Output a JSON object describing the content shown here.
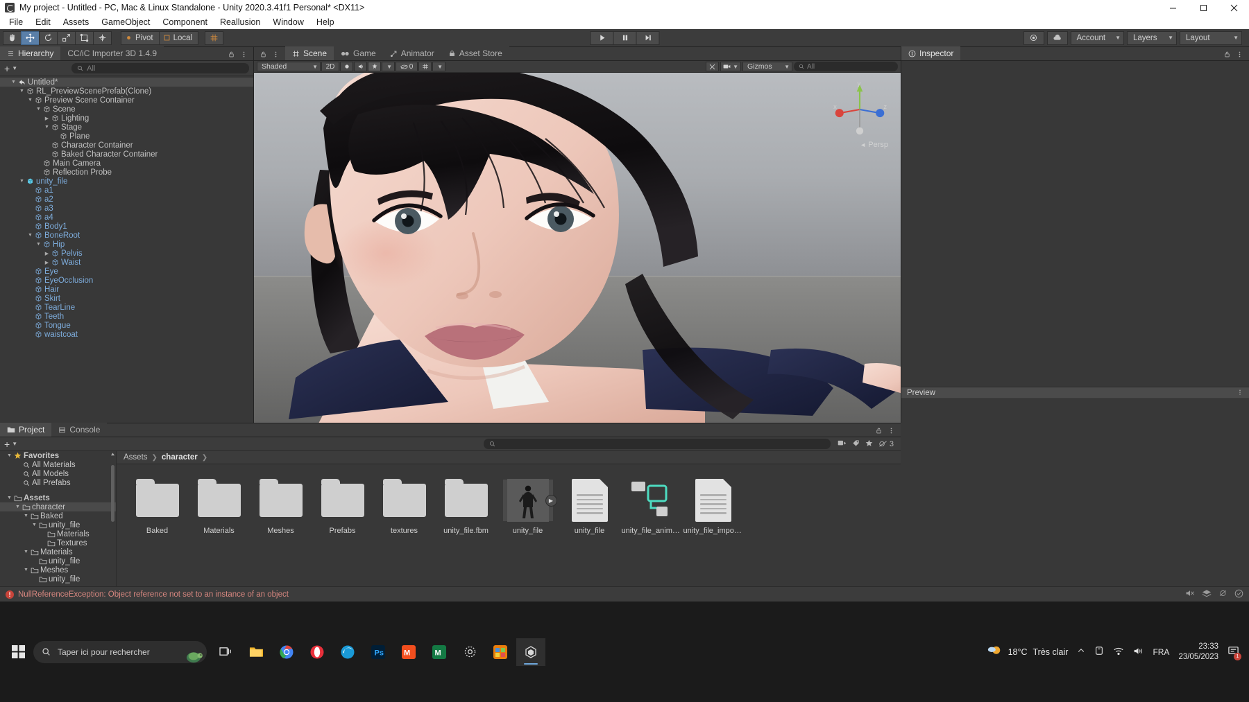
{
  "window": {
    "title": "My project - Untitled - PC, Mac & Linux Standalone - Unity 2020.3.41f1 Personal* <DX11>",
    "buttons": {
      "minimize": "minimize-icon",
      "maximize": "maximize-icon",
      "close": "close-icon"
    }
  },
  "menubar": {
    "items": [
      "File",
      "Edit",
      "Assets",
      "GameObject",
      "Component",
      "Reallusion",
      "Window",
      "Help"
    ]
  },
  "toolbar": {
    "tools": [
      {
        "name": "hand-tool",
        "glyph": "✋"
      },
      {
        "name": "move-tool",
        "glyph": "✥"
      },
      {
        "name": "rotate-tool",
        "glyph": "↻"
      },
      {
        "name": "scale-tool",
        "glyph": "◱"
      },
      {
        "name": "rect-tool",
        "glyph": "▧"
      },
      {
        "name": "transform-tool",
        "glyph": "✲"
      }
    ],
    "pivot_label": "Pivot",
    "local_label": "Local",
    "grid_toggle": "grid-snap-icon",
    "play": "▶",
    "pause": "❘❘",
    "step": "▶❘",
    "collab_label": "collab-icon",
    "cloud_label": "cloud-icon",
    "account_label": "Account",
    "layers_label": "Layers",
    "layout_label": "Layout"
  },
  "hierarchy": {
    "tabs": [
      {
        "label": "Hierarchy",
        "active": true,
        "icon": "hierarchy-icon"
      },
      {
        "label": "CC/iC Importer 3D 1.4.9",
        "active": false,
        "icon": ""
      }
    ],
    "add_label": "+",
    "search_placeholder": "All",
    "items": [
      {
        "label": "Untitled*",
        "depth": 0,
        "twirl": "down",
        "icon": "scene-icon",
        "prefab": false,
        "selected": true
      },
      {
        "label": "RL_PreviewScenePrefab(Clone)",
        "depth": 1,
        "twirl": "down",
        "icon": "cube-icon",
        "prefab": false
      },
      {
        "label": "Preview Scene Container",
        "depth": 2,
        "twirl": "down",
        "icon": "cube-icon",
        "prefab": false
      },
      {
        "label": "Scene",
        "depth": 3,
        "twirl": "down",
        "icon": "cube-icon",
        "prefab": false
      },
      {
        "label": "Lighting",
        "depth": 4,
        "twirl": "right",
        "icon": "cube-icon",
        "prefab": false
      },
      {
        "label": "Stage",
        "depth": 4,
        "twirl": "down",
        "icon": "cube-icon",
        "prefab": false
      },
      {
        "label": "Plane",
        "depth": 5,
        "twirl": "none",
        "icon": "cube-icon",
        "prefab": false
      },
      {
        "label": "Character Container",
        "depth": 4,
        "twirl": "none",
        "icon": "cube-icon",
        "prefab": false
      },
      {
        "label": "Baked Character Container",
        "depth": 4,
        "twirl": "none",
        "icon": "cube-icon",
        "prefab": false
      },
      {
        "label": "Main Camera",
        "depth": 3,
        "twirl": "none",
        "icon": "cube-icon",
        "prefab": false
      },
      {
        "label": "Reflection Probe",
        "depth": 3,
        "twirl": "none",
        "icon": "cube-icon",
        "prefab": false
      },
      {
        "label": "unity_file",
        "depth": 1,
        "twirl": "down",
        "icon": "prefab-icon",
        "prefab": true
      },
      {
        "label": "a1",
        "depth": 2,
        "twirl": "none",
        "icon": "cube-icon",
        "prefab": true
      },
      {
        "label": "a2",
        "depth": 2,
        "twirl": "none",
        "icon": "cube-icon",
        "prefab": true
      },
      {
        "label": "a3",
        "depth": 2,
        "twirl": "none",
        "icon": "cube-icon",
        "prefab": true
      },
      {
        "label": "a4",
        "depth": 2,
        "twirl": "none",
        "icon": "cube-icon",
        "prefab": true
      },
      {
        "label": "Body1",
        "depth": 2,
        "twirl": "none",
        "icon": "cube-icon",
        "prefab": true
      },
      {
        "label": "BoneRoot",
        "depth": 2,
        "twirl": "down",
        "icon": "cube-icon",
        "prefab": true
      },
      {
        "label": "Hip",
        "depth": 3,
        "twirl": "down",
        "icon": "cube-icon",
        "prefab": true
      },
      {
        "label": "Pelvis",
        "depth": 4,
        "twirl": "right",
        "icon": "cube-icon",
        "prefab": true
      },
      {
        "label": "Waist",
        "depth": 4,
        "twirl": "right",
        "icon": "cube-icon",
        "prefab": true
      },
      {
        "label": "Eye",
        "depth": 2,
        "twirl": "none",
        "icon": "cube-icon",
        "prefab": true
      },
      {
        "label": "EyeOcclusion",
        "depth": 2,
        "twirl": "none",
        "icon": "cube-icon",
        "prefab": true
      },
      {
        "label": "Hair",
        "depth": 2,
        "twirl": "none",
        "icon": "cube-icon",
        "prefab": true
      },
      {
        "label": "Skirt",
        "depth": 2,
        "twirl": "none",
        "icon": "cube-icon",
        "prefab": true
      },
      {
        "label": "TearLine",
        "depth": 2,
        "twirl": "none",
        "icon": "cube-icon",
        "prefab": true
      },
      {
        "label": "Teeth",
        "depth": 2,
        "twirl": "none",
        "icon": "cube-icon",
        "prefab": true
      },
      {
        "label": "Tongue",
        "depth": 2,
        "twirl": "none",
        "icon": "cube-icon",
        "prefab": true
      },
      {
        "label": "waistcoat",
        "depth": 2,
        "twirl": "none",
        "icon": "cube-icon",
        "prefab": true
      }
    ]
  },
  "scene": {
    "tabs": [
      {
        "label": "Scene",
        "active": true,
        "icon": "grid-icon"
      },
      {
        "label": "Game",
        "active": false,
        "icon": "gamepad-icon"
      },
      {
        "label": "Animator",
        "active": false,
        "icon": "animator-icon"
      },
      {
        "label": "Asset Store",
        "active": false,
        "icon": "store-icon"
      }
    ],
    "shading_mode": "Shaded",
    "mode_2d": "2D",
    "lighting_toggle": "lighting-icon",
    "audio_toggle": "audio-icon",
    "fx_toggle": "fx-icon",
    "hidden_count": "0",
    "gizmos_label": "Gizmos",
    "search_placeholder": "All",
    "gizmo": {
      "perspective_label": "Persp",
      "axes": [
        {
          "label": "x",
          "color": "#d9453d"
        },
        {
          "label": "y",
          "color": "#8bc34a"
        },
        {
          "label": "z",
          "color": "#3b6fd4"
        }
      ]
    }
  },
  "inspector": {
    "tab_label": "Inspector",
    "preview_label": "Preview"
  },
  "project": {
    "tabs": [
      {
        "label": "Project",
        "active": true,
        "icon": "folder-icon"
      },
      {
        "label": "Console",
        "active": false,
        "icon": "console-icon"
      }
    ],
    "add_label": "+",
    "search_placeholder": "",
    "asset_count": "3",
    "breadcrumb": [
      "Assets",
      "character"
    ],
    "tree": [
      {
        "label": "Favorites",
        "depth": 0,
        "twirl": "down",
        "icon": "star-icon",
        "bold": true
      },
      {
        "label": "All Materials",
        "depth": 1,
        "twirl": "none",
        "icon": "search-icon"
      },
      {
        "label": "All Models",
        "depth": 1,
        "twirl": "none",
        "icon": "search-icon"
      },
      {
        "label": "All Prefabs",
        "depth": 1,
        "twirl": "none",
        "icon": "search-icon"
      },
      {
        "label": "",
        "depth": 0,
        "twirl": "none",
        "icon": ""
      },
      {
        "label": "Assets",
        "depth": 0,
        "twirl": "down",
        "icon": "folder-icon",
        "bold": true
      },
      {
        "label": "character",
        "depth": 1,
        "twirl": "down",
        "icon": "folder-icon",
        "selected": true
      },
      {
        "label": "Baked",
        "depth": 2,
        "twirl": "down",
        "icon": "folder-icon"
      },
      {
        "label": "unity_file",
        "depth": 3,
        "twirl": "down",
        "icon": "folder-icon"
      },
      {
        "label": "Materials",
        "depth": 4,
        "twirl": "none",
        "icon": "folder-icon"
      },
      {
        "label": "Textures",
        "depth": 4,
        "twirl": "none",
        "icon": "folder-icon"
      },
      {
        "label": "Materials",
        "depth": 2,
        "twirl": "down",
        "icon": "folder-icon"
      },
      {
        "label": "unity_file",
        "depth": 3,
        "twirl": "none",
        "icon": "folder-icon"
      },
      {
        "label": "Meshes",
        "depth": 2,
        "twirl": "down",
        "icon": "folder-icon"
      },
      {
        "label": "unity_file",
        "depth": 3,
        "twirl": "none",
        "icon": "folder-icon"
      }
    ],
    "assets": [
      {
        "label": "Baked",
        "type": "folder"
      },
      {
        "label": "Materials",
        "type": "folder"
      },
      {
        "label": "Meshes",
        "type": "folder"
      },
      {
        "label": "Prefabs",
        "type": "folder"
      },
      {
        "label": "textures",
        "type": "folder"
      },
      {
        "label": "unity_file.fbm",
        "type": "folder"
      },
      {
        "label": "unity_file",
        "type": "model",
        "selected": true,
        "has_play": true
      },
      {
        "label": "unity_file",
        "type": "document"
      },
      {
        "label": "unity_file_animat...",
        "type": "controller"
      },
      {
        "label": "unity_file_importI...",
        "type": "document"
      }
    ]
  },
  "status": {
    "error_message": "NullReferenceException: Object reference not set to an instance of an object",
    "error_icon": "error-icon"
  },
  "taskbar": {
    "search_placeholder": "Taper ici pour rechercher",
    "start_icon": "windows-start-icon",
    "apps": [
      {
        "name": "task-view-icon",
        "active": false
      },
      {
        "name": "file-explorer-icon",
        "active": false
      },
      {
        "name": "chrome-icon",
        "active": false
      },
      {
        "name": "opera-icon",
        "active": false
      },
      {
        "name": "edge-icon",
        "active": false
      },
      {
        "name": "photoshop-icon",
        "active": false
      },
      {
        "name": "mixamo-icon",
        "active": false
      },
      {
        "name": "reallusion-icon",
        "active": false
      },
      {
        "name": "settings-icon",
        "active": false
      },
      {
        "name": "blender-icon",
        "active": false
      },
      {
        "name": "unity-icon",
        "active": true
      }
    ],
    "temperature": "18°C",
    "weather_text": "Très clair",
    "language": "FRA",
    "time": "23:33",
    "date": "23/05/2023",
    "notification_count": "1"
  },
  "colors": {
    "accent_blue": "#7eaddd",
    "error_red": "#c9443a",
    "panel_bg": "#383838",
    "toolbar_bg": "#3c3c3c",
    "selection": "#4a4a4a"
  }
}
